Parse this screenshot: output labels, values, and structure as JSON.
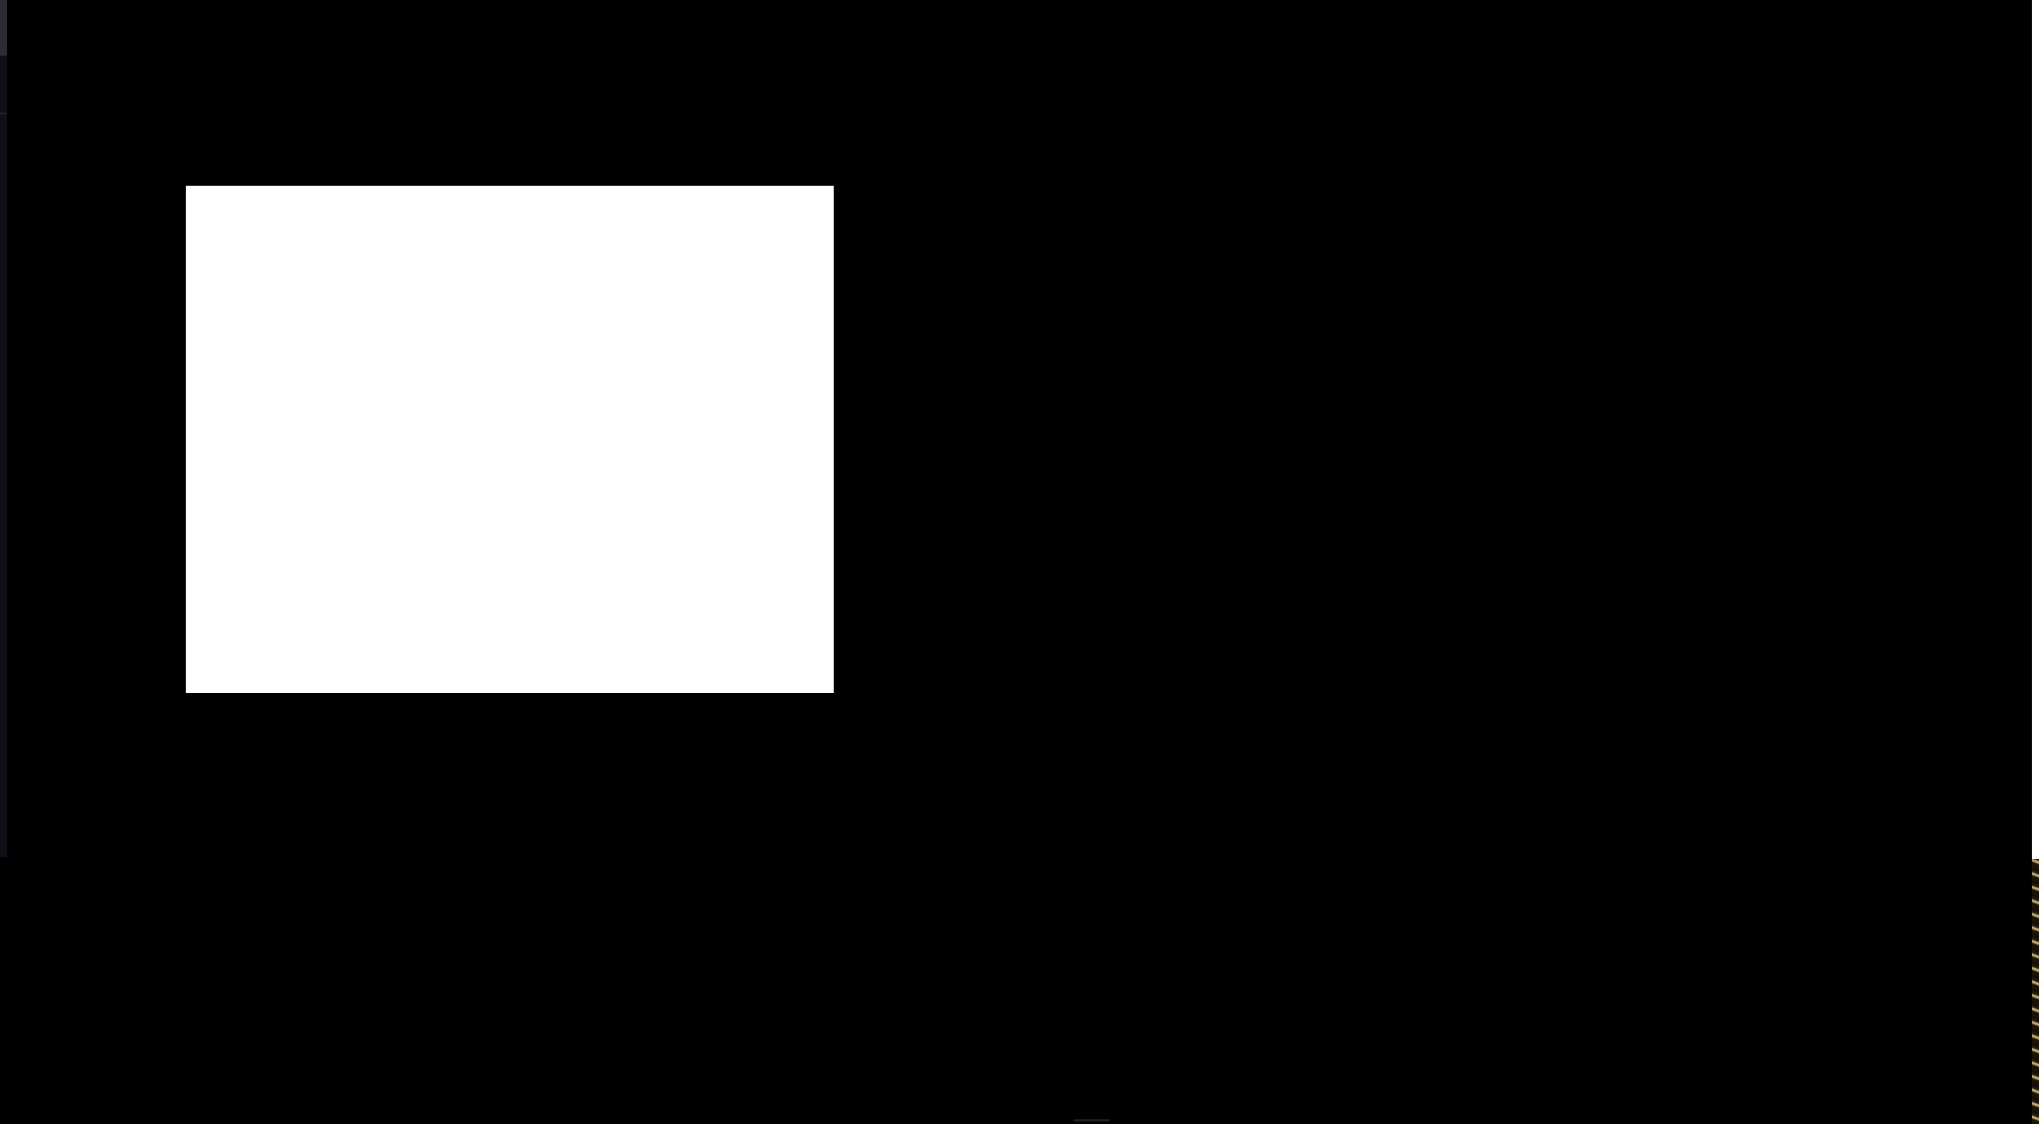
{
  "screen": {
    "background_color": "#000000",
    "panel_color": "#ffffff",
    "left_strip_color": "#0e1016",
    "left_strip_top_color": "#2b2d33",
    "right_edge_color": "#ffffff"
  }
}
